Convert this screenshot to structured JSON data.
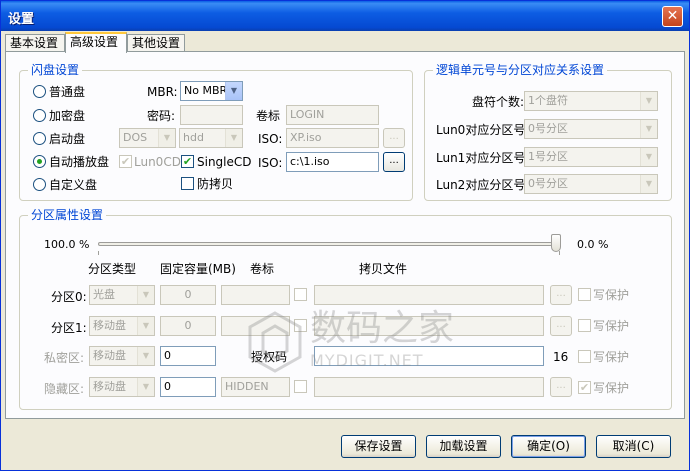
{
  "window": {
    "title": "设置",
    "close_glyph": "✕"
  },
  "tabs": [
    "基本设置",
    "高级设置",
    "其他设置"
  ],
  "flash": {
    "group_label": "闪盘设置",
    "radios": [
      "普通盘",
      "加密盘",
      "启动盘",
      "自动播放盘",
      "自定义盘"
    ],
    "selected_radio": "自动播放盘",
    "mbr_label": "MBR:",
    "mbr_value": "No MBR",
    "password_label": "密码:",
    "volume_label": "卷标",
    "volume_value": "LOGIN",
    "boot_type": "DOS",
    "boot_drive": "hdd",
    "iso_label": "ISO:",
    "iso1_value": "XP.iso",
    "iso2_value": "c:\\1.iso",
    "lun0cd_label": "Lun0CD",
    "singlecd_label": "SingleCD",
    "copyprotect_label": "防拷贝",
    "browse_label": "..."
  },
  "lun": {
    "group_label": "逻辑单元号与分区对应关系设置",
    "rows": [
      {
        "label": "盘符个数:",
        "value": "1个盘符"
      },
      {
        "label": "Lun0对应分区号:",
        "value": "0号分区"
      },
      {
        "label": "Lun1对应分区号:",
        "value": "1号分区"
      },
      {
        "label": "Lun2对应分区号:",
        "value": "0号分区"
      }
    ]
  },
  "partition": {
    "group_label": "分区属性设置",
    "slider_left": "100.0 %",
    "slider_right": "0.0 %",
    "slider_level": 1.0,
    "headers": {
      "type": "分区类型",
      "capacity": "固定容量(MB)",
      "volume": "卷标",
      "copyfile": "拷贝文件"
    },
    "rows": [
      {
        "label": "分区0:",
        "type": "光盘",
        "capacity": "0",
        "volume": "",
        "file": "",
        "protect": "写保护"
      },
      {
        "label": "分区1:",
        "type": "移动盘",
        "capacity": "0",
        "volume": "",
        "file": "",
        "protect": "写保护"
      },
      {
        "label": "私密区:",
        "type": "移动盘",
        "capacity": "0",
        "auth_label": "授权码",
        "auth_count": "16",
        "protect": "写保护"
      },
      {
        "label": "隐藏区:",
        "type": "移动盘",
        "capacity": "0",
        "volume": "HIDDEN",
        "file": "",
        "protect": "写保护"
      }
    ]
  },
  "buttons": {
    "save": "保存设置",
    "load": "加载设置",
    "ok": "确定(O)",
    "cancel": "取消(C)"
  },
  "watermark": {
    "text": "数码之家",
    "sub": "MYDIGIT.NET"
  },
  "colors": {
    "title_bar": "#0549d2",
    "group_label": "#0046d5",
    "check_green": "#21a121"
  }
}
